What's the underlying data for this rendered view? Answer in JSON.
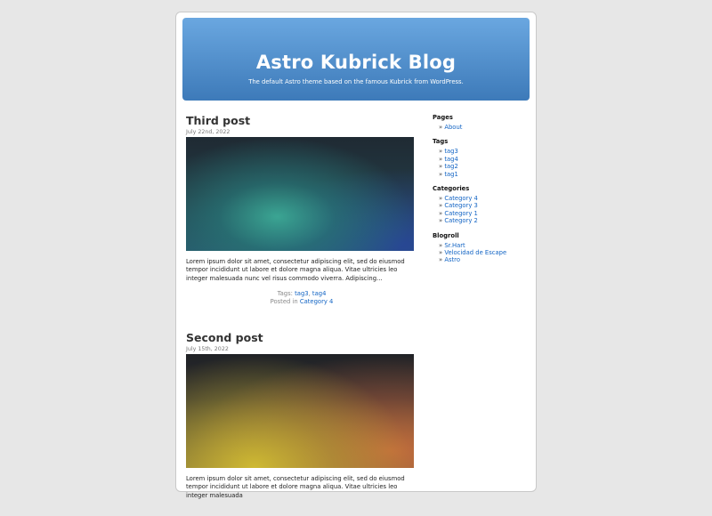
{
  "header": {
    "title": "Astro Kubrick Blog",
    "description": "The default Astro theme based on the famous Kubrick from WordPress."
  },
  "posts": [
    {
      "title": "Third post",
      "date": "July 22nd, 2022",
      "excerpt": "Lorem ipsum dolor sit amet, consectetur adipiscing elit, sed do eiusmod tempor incididunt ut labore et dolore magna aliqua. Vitae ultricies leo integer malesuada nunc vel risus commodo viverra. Adipiscing...",
      "tags_label": "Tags:",
      "tags": [
        "tag3",
        "tag4"
      ],
      "posted_in_label": "Posted in",
      "category": "Category 4"
    },
    {
      "title": "Second post",
      "date": "July 15th, 2022",
      "excerpt": "Lorem ipsum dolor sit amet, consectetur adipiscing elit, sed do eiusmod tempor incididunt ut labore et dolore magna aliqua. Vitae ultricies leo integer malesuada"
    }
  ],
  "sidebar": {
    "pages": {
      "heading": "Pages",
      "items": [
        "About"
      ]
    },
    "tags": {
      "heading": "Tags",
      "items": [
        "tag3",
        "tag4",
        "tag2",
        "tag1"
      ]
    },
    "categories": {
      "heading": "Categories",
      "items": [
        "Category 4",
        "Category 3",
        "Category 1",
        "Category 2"
      ]
    },
    "blogroll": {
      "heading": "Blogroll",
      "items": [
        "Sr.Hart",
        "Velocidad de Escape",
        "Astro"
      ]
    }
  },
  "colors": {
    "background": "#e7e7e7",
    "header_top": "#6aa7e0",
    "header_bottom": "#3d7ab9",
    "link": "#1264c4"
  }
}
